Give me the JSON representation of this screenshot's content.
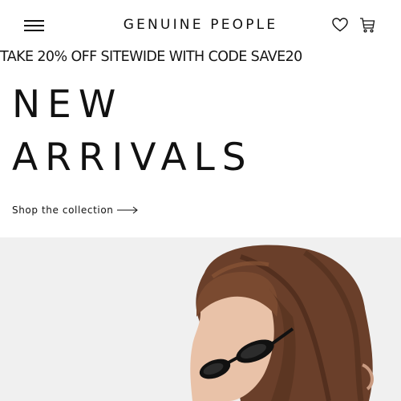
{
  "header": {
    "menu_icon": "hamburger-icon",
    "brand": "GENUINE PEOPLE",
    "wishlist_icon": "heart-icon",
    "cart_icon": "shopping-bag-icon"
  },
  "promo": {
    "text": "TAKE 20% OFF SITEWIDE WITH CODE SAVE20"
  },
  "hero": {
    "title_line1": "NEW",
    "title_line2": "ARRIVALS",
    "cta_label": "Shop the collection",
    "cta_icon": "long-arrow-right-icon",
    "image_subject": "woman-with-sunglasses-photo",
    "image_background": "#f0f0f0"
  }
}
